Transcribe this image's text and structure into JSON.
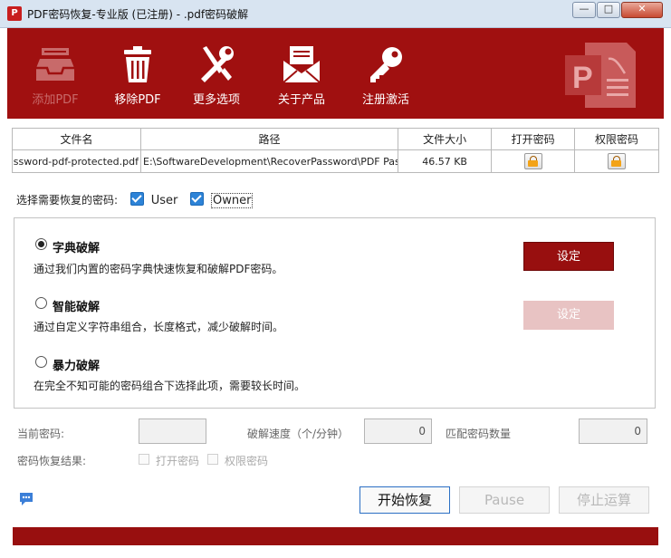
{
  "window": {
    "title": "PDF密码恢复-专业版 (已注册) - .pdf密码破解",
    "app_icon_glyph": "P",
    "controls": {
      "minimize": "—",
      "maximize": "□",
      "close": "✕"
    }
  },
  "toolbar": {
    "items": [
      {
        "label": "添加PDF",
        "icon": "inbox-tray-icon",
        "enabled": false
      },
      {
        "label": "移除PDF",
        "icon": "trash-icon",
        "enabled": true
      },
      {
        "label": "更多选项",
        "icon": "tools-icon",
        "enabled": true
      },
      {
        "label": "关于产品",
        "icon": "envelope-icon",
        "enabled": true
      },
      {
        "label": "注册激活",
        "icon": "key-icon",
        "enabled": true
      }
    ],
    "logo_icon": "pdf-logo-icon"
  },
  "file_table": {
    "columns": [
      "文件名",
      "路径",
      "文件大小",
      "打开密码",
      "权限密码"
    ],
    "rows": [
      {
        "name": "password-pdf-protected.pdf",
        "path": "E:\\SoftwareDevelopment\\RecoverPassword\\PDF Password",
        "size": "46.57 KB",
        "open_password": "lock-icon",
        "perm_password": "lock-icon"
      }
    ]
  },
  "password_select": {
    "label": "选择需要恢复的密码:",
    "user": {
      "label": "User",
      "checked": true
    },
    "owner": {
      "label": "Owner",
      "checked": true
    }
  },
  "methods": [
    {
      "title": "字典破解",
      "desc": "通过我们内置的密码字典快速恢复和破解PDF密码。",
      "selected": true,
      "button": "设定",
      "button_enabled": true
    },
    {
      "title": "智能破解",
      "desc": "通过自定义字符串组合，长度格式，减少破解时间。",
      "selected": false,
      "button": "设定",
      "button_enabled": false
    },
    {
      "title": "暴力破解",
      "desc": "在完全不知可能的密码组合下选择此项，需要较长时间。",
      "selected": false
    }
  ],
  "status": {
    "current_password_label": "当前密码:",
    "current_password_value": "",
    "speed_label": "破解速度（个/分钟）",
    "speed_value": "0",
    "match_label": "匹配密码数量",
    "match_value": "0",
    "result_label": "密码恢复结果:",
    "result_open": "打开密码",
    "result_perm": "权限密码"
  },
  "actions": {
    "start": "开始恢复",
    "pause": "Pause",
    "stop": "停止运算"
  },
  "colors": {
    "brand": "#a01010",
    "button": "#980f0f",
    "button_disabled": "#e8c3c3"
  }
}
